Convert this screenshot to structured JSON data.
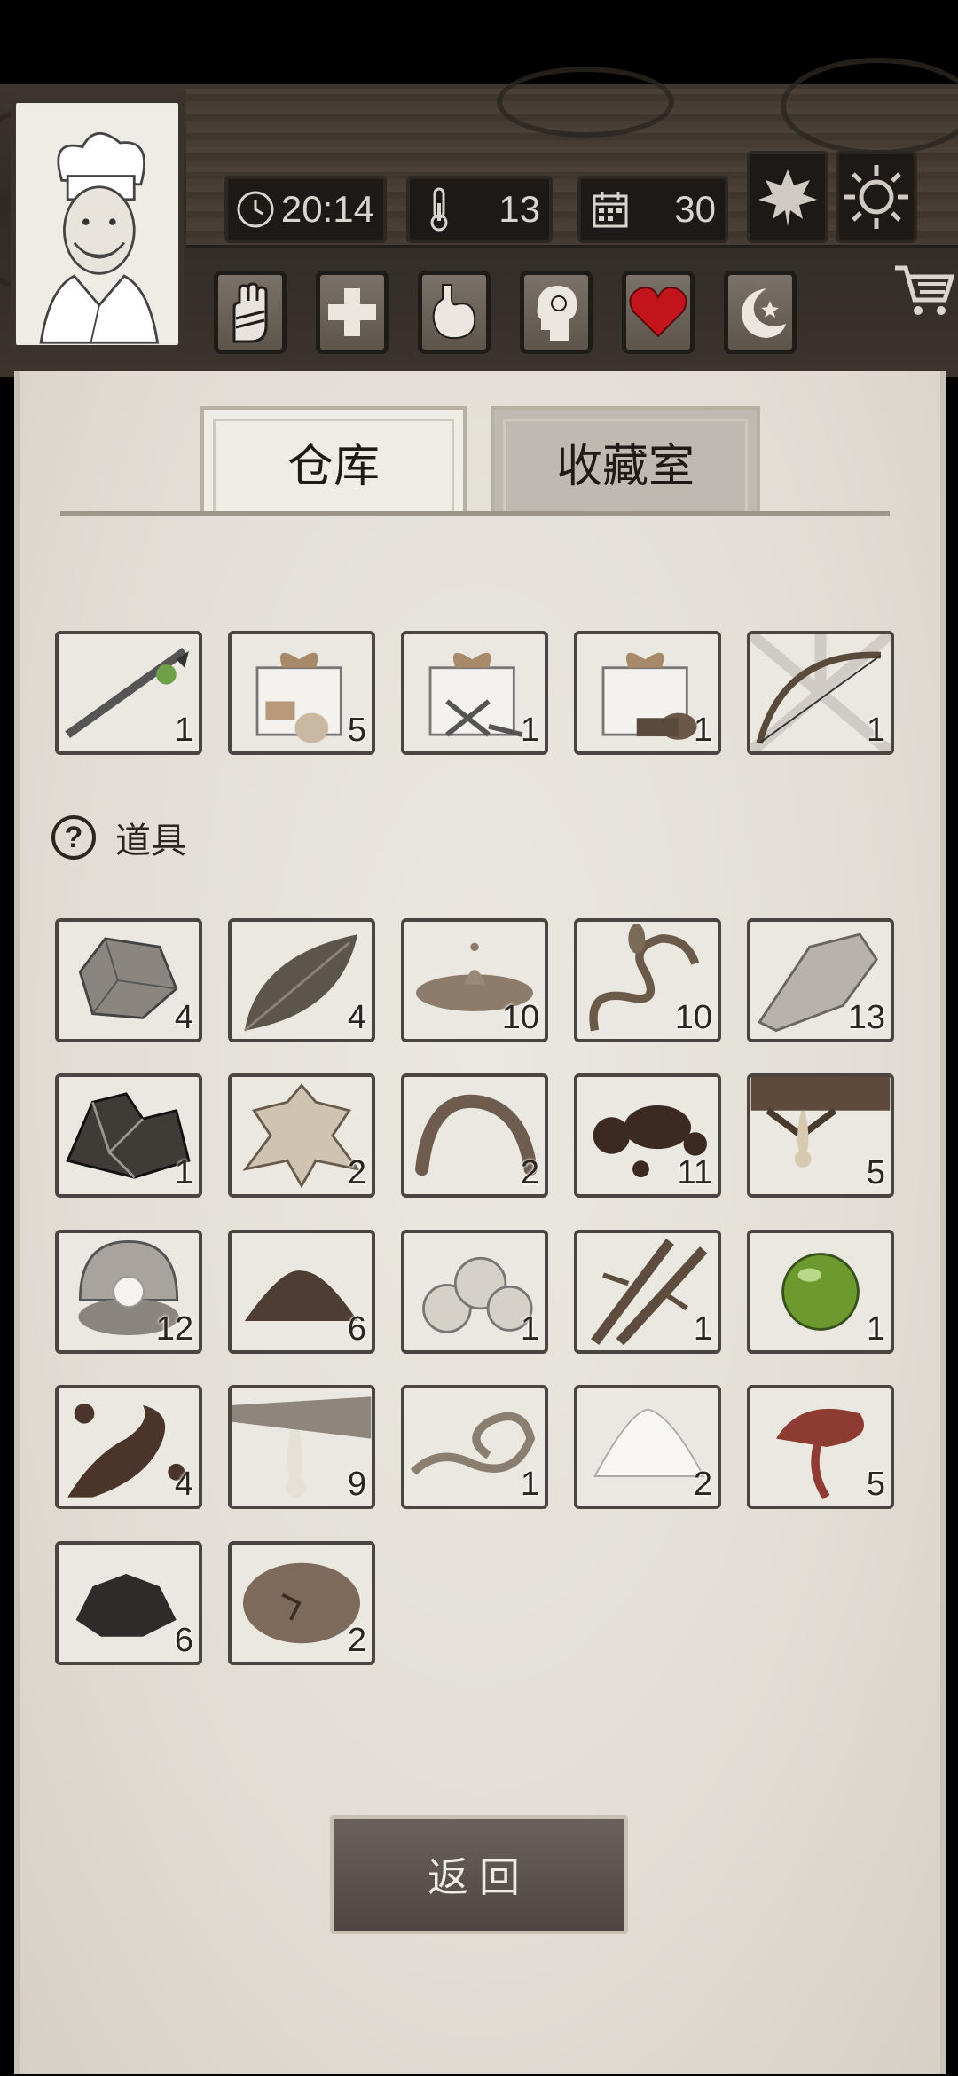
{
  "stats": {
    "time": "20:14",
    "temperature": "13",
    "day": "30"
  },
  "tabs": [
    {
      "label": "仓库"
    },
    {
      "label": "收藏室"
    }
  ],
  "top_items": [
    {
      "icon": "spear-icon",
      "count": "1"
    },
    {
      "icon": "gift-box-food-icon",
      "count": "5"
    },
    {
      "icon": "gift-box-tools-icon",
      "count": "1"
    },
    {
      "icon": "gift-box-wood-icon",
      "count": "1"
    },
    {
      "icon": "bow-icon",
      "count": "1"
    }
  ],
  "section": {
    "title": "道具",
    "icon": "question-icon"
  },
  "items": [
    {
      "icon": "stone-icon",
      "count": "4"
    },
    {
      "icon": "leaf-icon",
      "count": "4"
    },
    {
      "icon": "mud-puddle-icon",
      "count": "10"
    },
    {
      "icon": "vine-icon",
      "count": "10"
    },
    {
      "icon": "flint-icon",
      "count": "13"
    },
    {
      "icon": "ore-icon",
      "count": "1"
    },
    {
      "icon": "animal-hide-icon",
      "count": "2"
    },
    {
      "icon": "worm-icon",
      "count": "2"
    },
    {
      "icon": "tar-icon",
      "count": "11"
    },
    {
      "icon": "resin-icon",
      "count": "5"
    },
    {
      "icon": "pearl-icon",
      "count": "12"
    },
    {
      "icon": "soil-icon",
      "count": "6"
    },
    {
      "icon": "cotton-icon",
      "count": "1"
    },
    {
      "icon": "bamboo-icon",
      "count": "1"
    },
    {
      "icon": "green-gem-icon",
      "count": "1"
    },
    {
      "icon": "oil-splash-icon",
      "count": "4"
    },
    {
      "icon": "fish-oil-icon",
      "count": "9"
    },
    {
      "icon": "rope-icon",
      "count": "1"
    },
    {
      "icon": "salt-icon",
      "count": "2"
    },
    {
      "icon": "mushroom-icon",
      "count": "5"
    },
    {
      "icon": "coal-icon",
      "count": "6"
    },
    {
      "icon": "truffle-icon",
      "count": "2"
    }
  ],
  "back_button": {
    "label": "返回"
  }
}
